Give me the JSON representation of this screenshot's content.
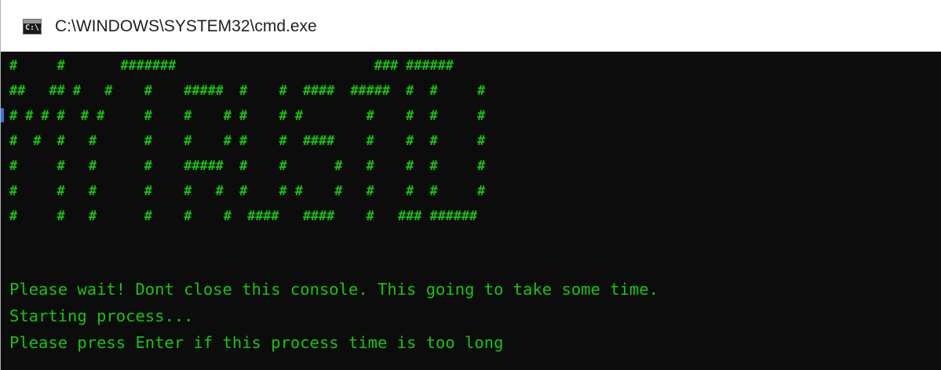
{
  "window": {
    "title": "C:\\WINDOWS\\SYSTEM32\\cmd.exe",
    "icon": "cmd-console-icon",
    "icon_glyph": "C:\\."
  },
  "console": {
    "text_color": "#16c60c",
    "background_color": "#0c0c0c",
    "banner_lines": [
      "#     #       #######                         ### ######",
      "##   ## #   #    #    #####  #    #  ####  #####  #  #     #",
      "# # # #  # #     #    #    # #    # #        #    #  #     #",
      "#  #  #   #      #    #    # #    #  ####    #    #  #     #",
      "#     #   #      #    #####  #    #      #   #    #  #     #",
      "#     #   #      #    #   #  #    # #    #   #    #  #     #",
      "#     #   #      #    #    #  ####   ####    #   ### ######"
    ],
    "messages": [
      "Please wait! Dont close this console. This going to take some time.",
      "Starting process...",
      "Please press Enter if this process time is too long"
    ]
  }
}
